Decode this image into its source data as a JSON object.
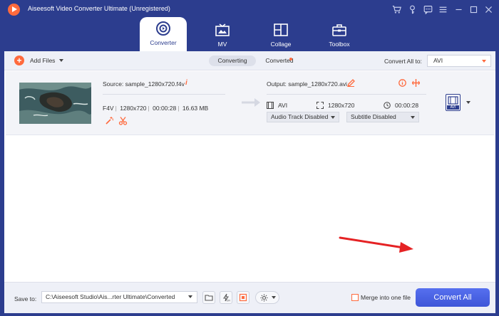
{
  "window": {
    "title": "Aiseesoft Video Converter Ultimate (Unregistered)",
    "colors": {
      "primary": "#2c3d8e",
      "accent": "#ff6a3d",
      "button": "#4a63e6"
    }
  },
  "titlebar_icons": [
    "cart-icon",
    "key-icon",
    "feedback-icon",
    "menu-icon",
    "minimize-icon",
    "maximize-icon",
    "close-icon"
  ],
  "tabs": [
    {
      "label": "Converter",
      "icon": "converter-icon",
      "active": true
    },
    {
      "label": "MV",
      "icon": "mv-icon",
      "active": false
    },
    {
      "label": "Collage",
      "icon": "collage-icon",
      "active": false
    },
    {
      "label": "Toolbox",
      "icon": "toolbox-icon",
      "active": false
    }
  ],
  "toolbar": {
    "add_files": "Add Files",
    "converting": "Converting",
    "converted": "Converted",
    "convert_all_to": "Convert All to:",
    "convert_all_format": "AVI"
  },
  "file": {
    "source": "Source: sample_1280x720.f4v",
    "format": "F4V",
    "resolution": "1280x720",
    "duration": "00:00:28",
    "size": "16.63 MB",
    "output": "Output: sample_1280x720.avi",
    "out_format": "AVI",
    "out_resolution": "1280x720",
    "out_duration": "00:00:28",
    "audio_track": "Audio Track Disabled",
    "subtitle": "Subtitle Disabled",
    "badge": "AVI"
  },
  "bottom": {
    "save_to_label": "Save to:",
    "save_path": "C:\\Aiseesoft Studio\\Ais...rter Ultimate\\Converted",
    "merge_label": "Merge into one file",
    "convert_all_button": "Convert All"
  }
}
